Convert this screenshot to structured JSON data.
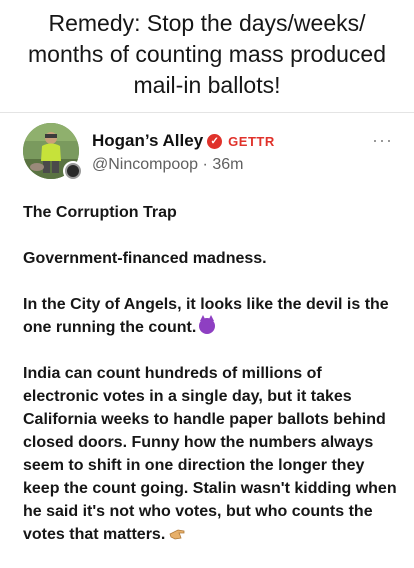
{
  "headline": {
    "line1": "Remedy: Stop the days/weeks/",
    "line2": "months of counting mass produced",
    "line3": "mail-in ballots!"
  },
  "post": {
    "author_name": "Hogan’s Alley",
    "source_label": "GETTR",
    "handle": "@Nincompoop",
    "separator": "·",
    "timestamp": "36m",
    "more_label": "···",
    "paragraphs": {
      "p1": "The Corruption Trap",
      "p2": "Government-financed madness.",
      "p3": "In the City of Angels, it looks like the devil is the one running the count.",
      "p4": "India can count hundreds of millions of electronic votes in a single day, but it takes California weeks to handle paper ballots behind closed doors. Funny how the numbers always seem to shift in one direction the longer they keep the count going. Stalin wasn't kidding when he said it's not who votes, but who counts the votes that matters."
    },
    "icons": {
      "verified": "verified-badge-icon",
      "devil": "smiling-imp-emoji",
      "hand": "hand-pointing-emoji"
    },
    "colors": {
      "accent": "#e0322b",
      "handle": "#606060"
    }
  }
}
